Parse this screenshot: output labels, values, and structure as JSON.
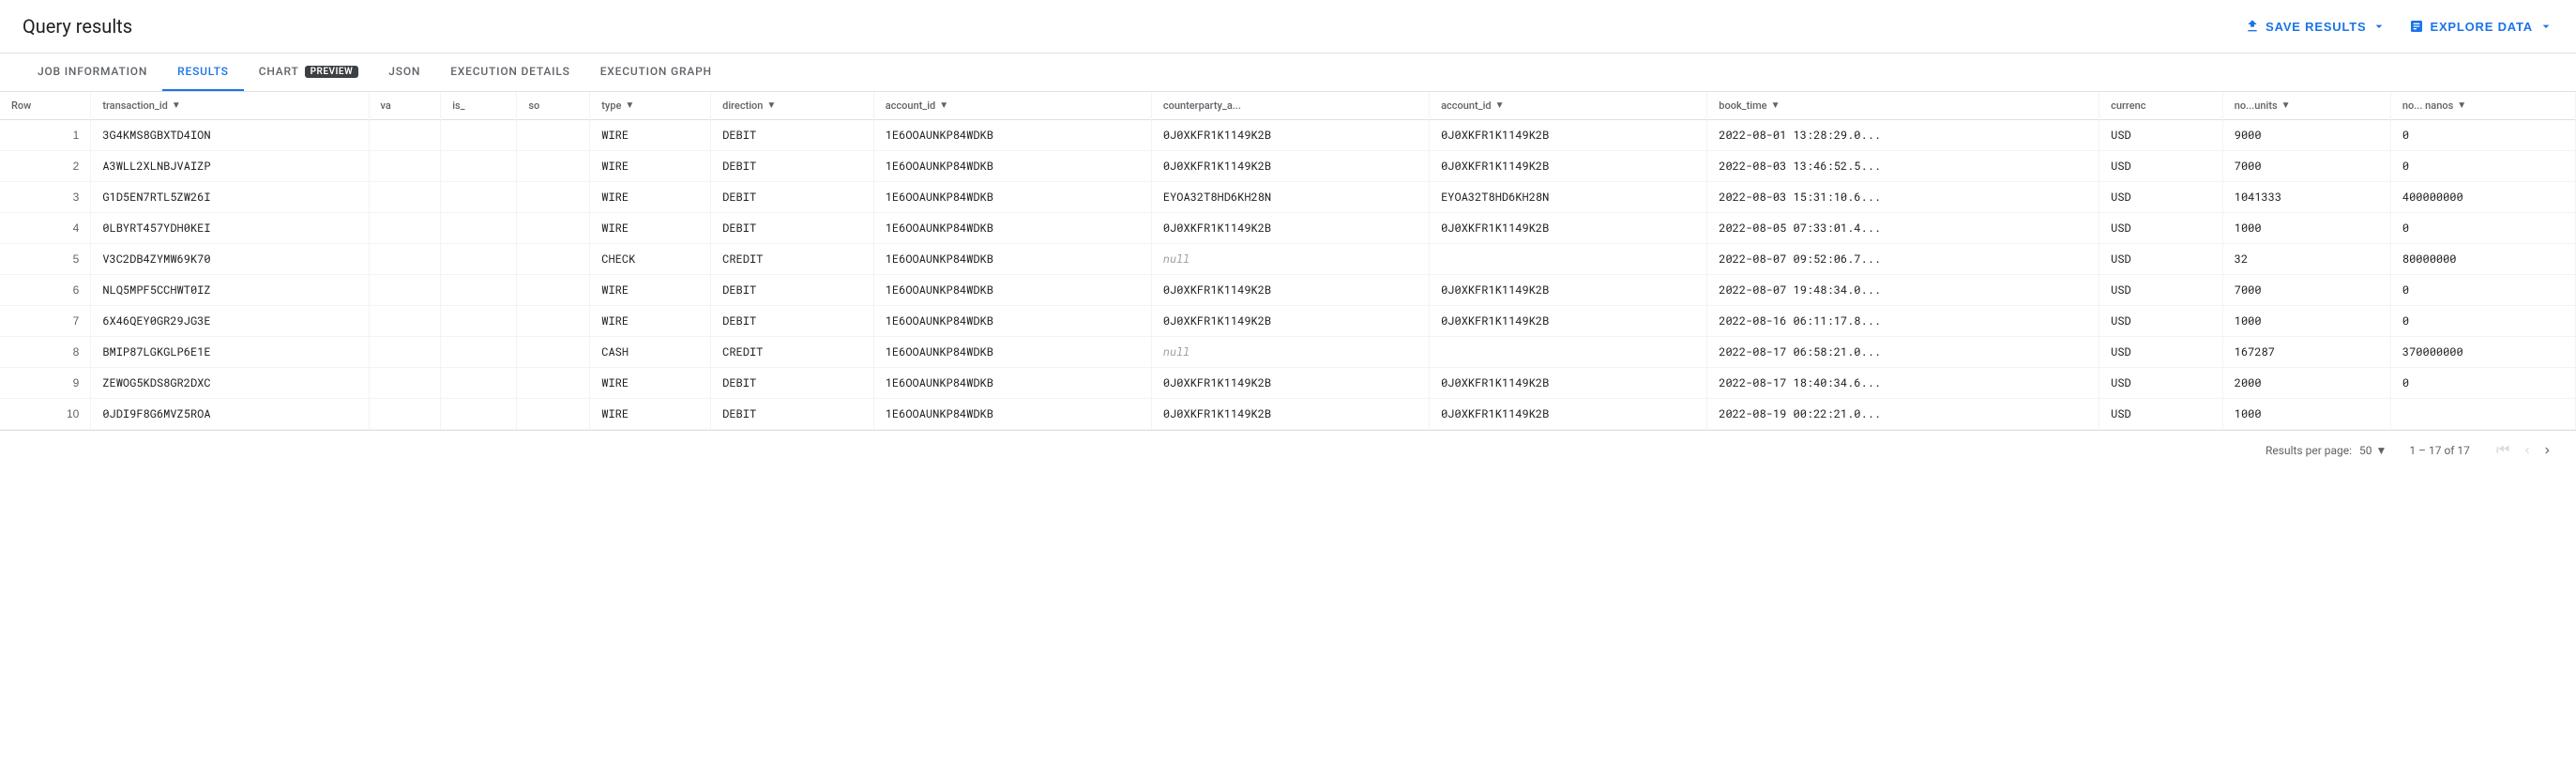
{
  "header": {
    "title": "Query results",
    "save_results_label": "SAVE RESULTS",
    "explore_data_label": "EXPLORE DATA"
  },
  "tabs": [
    {
      "id": "job-information",
      "label": "JOB INFORMATION",
      "active": false
    },
    {
      "id": "results",
      "label": "RESULTS",
      "active": true
    },
    {
      "id": "chart",
      "label": "CHART",
      "active": false
    },
    {
      "id": "preview",
      "label": "PREVIEW",
      "active": false,
      "has_preview_badge": true
    },
    {
      "id": "json",
      "label": "JSON",
      "active": false
    },
    {
      "id": "execution-details",
      "label": "EXECUTION DETAILS",
      "active": false
    },
    {
      "id": "execution-graph",
      "label": "EXECUTION GRAPH",
      "active": false
    }
  ],
  "table": {
    "columns": [
      {
        "id": "row",
        "label": "Row"
      },
      {
        "id": "transaction_id",
        "label": "transaction_id",
        "sortable": true
      },
      {
        "id": "va",
        "label": "va",
        "sortable": false
      },
      {
        "id": "is_",
        "label": "is_",
        "sortable": false
      },
      {
        "id": "so",
        "label": "so",
        "sortable": false
      },
      {
        "id": "type",
        "label": "type",
        "sortable": true
      },
      {
        "id": "direction",
        "label": "direction",
        "sortable": true
      },
      {
        "id": "account_id",
        "label": "account_id",
        "sortable": true
      },
      {
        "id": "counterparty_a",
        "label": "counterparty_a...",
        "sortable": false
      },
      {
        "id": "cp_account_id",
        "label": "account_id",
        "sortable": true
      },
      {
        "id": "book_time",
        "label": "book_time",
        "sortable": true
      },
      {
        "id": "currenc",
        "label": "currenc",
        "sortable": false
      },
      {
        "id": "no_units",
        "label": "no...units",
        "sortable": true
      },
      {
        "id": "no_nanos",
        "label": "no... nanos",
        "sortable": true
      }
    ],
    "rows": [
      {
        "row": 1,
        "transaction_id": "3G4KMS8GBXTD4ION",
        "va": "",
        "is_": "",
        "so": "",
        "type": "WIRE",
        "direction": "DEBIT",
        "account_id": "1E6OOAUNKP84WDKB",
        "counterparty_a": "0J0XKFR1K1149K2B",
        "cp_account_id": "0J0XKFR1K1149K2B",
        "book_time": "2022-08-01 13:28:29.0...",
        "currenc": "USD",
        "no_units": "9000",
        "no_nanos": "0",
        "no_nanos_null": false
      },
      {
        "row": 2,
        "transaction_id": "A3WLL2XLNBJVAIZP",
        "va": "",
        "is_": "",
        "so": "",
        "type": "WIRE",
        "direction": "DEBIT",
        "account_id": "1E6OOAUNKP84WDKB",
        "counterparty_a": "0J0XKFR1K1149K2B",
        "cp_account_id": "0J0XKFR1K1149K2B",
        "book_time": "2022-08-03 13:46:52.5...",
        "currenc": "USD",
        "no_units": "7000",
        "no_nanos": "0",
        "no_nanos_null": false
      },
      {
        "row": 3,
        "transaction_id": "G1D5EN7RTL5ZW26I",
        "va": "",
        "is_": "",
        "so": "",
        "type": "WIRE",
        "direction": "DEBIT",
        "account_id": "1E6OOAUNKP84WDKB",
        "counterparty_a": "EYOA32T8HD6KH28N",
        "cp_account_id": "EYOA32T8HD6KH28N",
        "book_time": "2022-08-03 15:31:10.6...",
        "currenc": "USD",
        "no_units": "1041333",
        "no_nanos": "400000000",
        "no_nanos_null": false
      },
      {
        "row": 4,
        "transaction_id": "0LBYRT457YDH0KEI",
        "va": "",
        "is_": "",
        "so": "",
        "type": "WIRE",
        "direction": "DEBIT",
        "account_id": "1E6OOAUNKP84WDKB",
        "counterparty_a": "0J0XKFR1K1149K2B",
        "cp_account_id": "0J0XKFR1K1149K2B",
        "book_time": "2022-08-05 07:33:01.4...",
        "currenc": "USD",
        "no_units": "1000",
        "no_nanos": "0",
        "no_nanos_null": false
      },
      {
        "row": 5,
        "transaction_id": "V3C2DB4ZYMW69K70",
        "va": "",
        "is_": "",
        "so": "",
        "type": "CHECK",
        "direction": "CREDIT",
        "account_id": "1E6OOAUNKP84WDKB",
        "counterparty_a": "null",
        "cp_account_id": "",
        "book_time": "2022-08-07 09:52:06.7...",
        "currenc": "USD",
        "no_units": "32",
        "no_nanos": "80000000",
        "no_nanos_null": false,
        "cp_is_null": true
      },
      {
        "row": 6,
        "transaction_id": "NLQ5MPF5CCHWT0IZ",
        "va": "",
        "is_": "",
        "so": "",
        "type": "WIRE",
        "direction": "DEBIT",
        "account_id": "1E6OOAUNKP84WDKB",
        "counterparty_a": "0J0XKFR1K1149K2B",
        "cp_account_id": "0J0XKFR1K1149K2B",
        "book_time": "2022-08-07 19:48:34.0...",
        "currenc": "USD",
        "no_units": "7000",
        "no_nanos": "0",
        "no_nanos_null": false
      },
      {
        "row": 7,
        "transaction_id": "6X46QEY0GR29JG3E",
        "va": "",
        "is_": "",
        "so": "",
        "type": "WIRE",
        "direction": "DEBIT",
        "account_id": "1E6OOAUNKP84WDKB",
        "counterparty_a": "0J0XKFR1K1149K2B",
        "cp_account_id": "0J0XKFR1K1149K2B",
        "book_time": "2022-08-16 06:11:17.8...",
        "currenc": "USD",
        "no_units": "1000",
        "no_nanos": "0",
        "no_nanos_null": false
      },
      {
        "row": 8,
        "transaction_id": "BMIP87LGKGLP6E1E",
        "va": "",
        "is_": "",
        "so": "",
        "type": "CASH",
        "direction": "CREDIT",
        "account_id": "1E6OOAUNKP84WDKB",
        "counterparty_a": "null",
        "cp_account_id": "",
        "book_time": "2022-08-17 06:58:21.0...",
        "currenc": "USD",
        "no_units": "167287",
        "no_nanos": "370000000",
        "no_nanos_null": false,
        "cp_is_null": true
      },
      {
        "row": 9,
        "transaction_id": "ZEWOG5KDS8GR2DXC",
        "va": "",
        "is_": "",
        "so": "",
        "type": "WIRE",
        "direction": "DEBIT",
        "account_id": "1E6OOAUNKP84WDKB",
        "counterparty_a": "0J0XKFR1K1149K2B",
        "cp_account_id": "0J0XKFR1K1149K2B",
        "book_time": "2022-08-17 18:40:34.6...",
        "currenc": "USD",
        "no_units": "2000",
        "no_nanos": "0",
        "no_nanos_null": false
      },
      {
        "row": 10,
        "transaction_id": "0JDI9F8G6MVZ5ROA",
        "va": "",
        "is_": "",
        "so": "",
        "type": "WIRE",
        "direction": "DEBIT",
        "account_id": "1E6OOAUNKP84WDKB",
        "counterparty_a": "0J0XKFR1K1149K2B",
        "cp_account_id": "0J0XKFR1K1149K2B",
        "book_time": "2022-08-19 00:22:21.0...",
        "currenc": "USD",
        "no_units": "1000",
        "no_nanos": "",
        "no_nanos_null": false
      }
    ]
  },
  "footer": {
    "results_per_page_label": "Results per page:",
    "per_page_value": "50",
    "page_range": "1 – 17 of 17"
  }
}
